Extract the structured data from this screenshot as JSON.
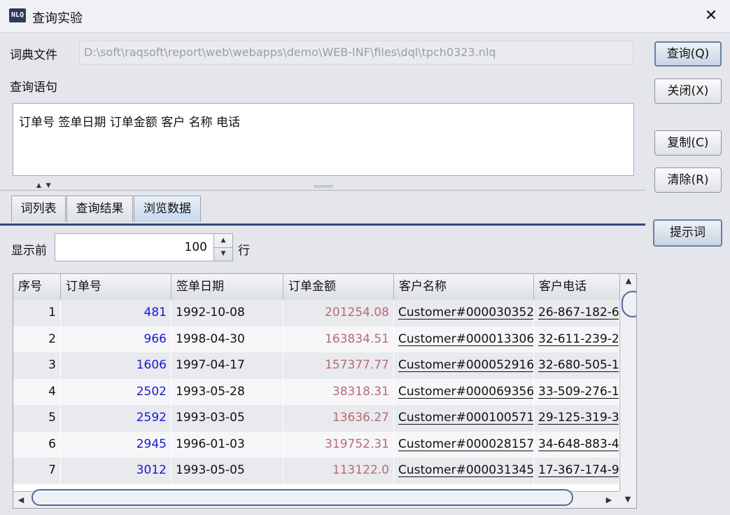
{
  "window": {
    "title": "查询实验",
    "logo_text": "NLQ",
    "close_glyph": "✕"
  },
  "form": {
    "dict_label": "词典文件",
    "dict_path": "D:\\soft\\raqsoft\\report\\web\\webapps\\demo\\WEB-INF\\files\\dql\\tpch0323.nlq",
    "query_label": "查询语句",
    "query_text": "订单号 签单日期 订单金额 客户 名称 电话"
  },
  "buttons": {
    "query": "查询(Q)",
    "close": "关闭(X)",
    "copy": "复制(C)",
    "clear": "清除(R)",
    "hint": "提示词"
  },
  "tabs": [
    {
      "label": "词列表",
      "active": false
    },
    {
      "label": "查询结果",
      "active": false
    },
    {
      "label": "浏览数据",
      "active": true
    }
  ],
  "browse": {
    "show_label": "显示前",
    "row_count": "100",
    "rows_label": "行"
  },
  "table": {
    "columns": [
      "序号",
      "订单号",
      "签单日期",
      "订单金额",
      "客户名称",
      "客户电话"
    ],
    "rows": [
      [
        "1",
        "481",
        "1992-10-08",
        "201254.08",
        "Customer#000030352",
        "26-867-182-6"
      ],
      [
        "2",
        "966",
        "1998-04-30",
        "163834.51",
        "Customer#000013306",
        "32-611-239-2"
      ],
      [
        "3",
        "1606",
        "1997-04-17",
        "157377.77",
        "Customer#000052916",
        "32-680-505-1"
      ],
      [
        "4",
        "2502",
        "1993-05-28",
        "38318.31",
        "Customer#000069356",
        "33-509-276-1"
      ],
      [
        "5",
        "2592",
        "1993-03-05",
        "13636.27",
        "Customer#000100571",
        "29-125-319-3"
      ],
      [
        "6",
        "2945",
        "1996-01-03",
        "319752.31",
        "Customer#000028157",
        "34-648-883-4"
      ],
      [
        "7",
        "3012",
        "1993-05-05",
        "113122.0",
        "Customer#000031345",
        "17-367-174-9"
      ]
    ]
  },
  "icons": {
    "split_arrows": "▲ ▼",
    "spin_up": "▲",
    "spin_down": "▼",
    "scroll_up": "▲",
    "scroll_down": "▼",
    "scroll_left": "◀",
    "scroll_right": "▶"
  }
}
